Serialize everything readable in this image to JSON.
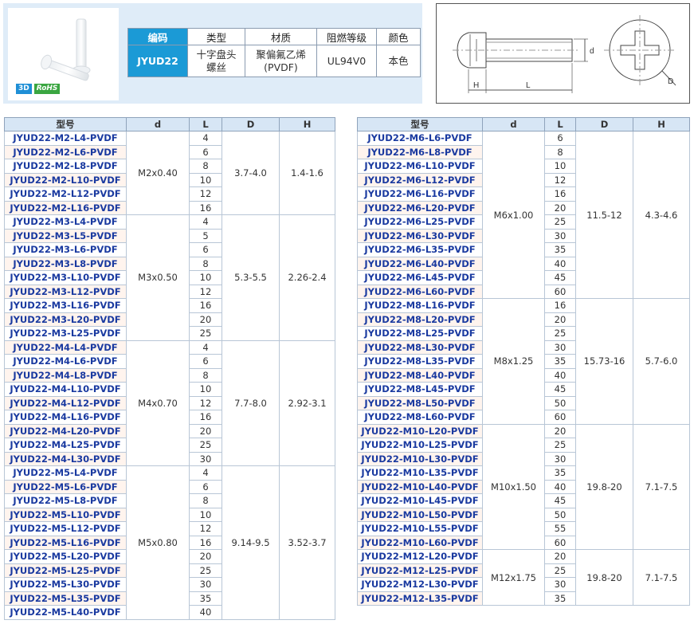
{
  "badges": {
    "threed": "3D",
    "rohs": "RoHS"
  },
  "spec": {
    "headers": [
      "编码",
      "类型",
      "材质",
      "阻燃等级",
      "颜色"
    ],
    "code": "JYUD22",
    "type_line1": "十字盘头",
    "type_line2": "螺丝",
    "material_line1": "聚偏氟乙烯",
    "material_line2": "(PVDF)",
    "flame": "UL94V0",
    "color": "本色"
  },
  "drawing": {
    "label_d": "d",
    "label_H": "H",
    "label_L": "L",
    "label_D": "D"
  },
  "table_headers": [
    "型号",
    "d",
    "L",
    "D",
    "H"
  ],
  "left_groups": [
    {
      "d": "M2x0.40",
      "D": "3.7-4.0",
      "H": "1.4-1.6",
      "rows": [
        {
          "model": "JYUD22-M2-L4-PVDF",
          "L": "4"
        },
        {
          "model": "JYUD22-M2-L6-PVDF",
          "L": "6"
        },
        {
          "model": "JYUD22-M2-L8-PVDF",
          "L": "8"
        },
        {
          "model": "JYUD22-M2-L10-PVDF",
          "L": "10"
        },
        {
          "model": "JYUD22-M2-L12-PVDF",
          "L": "12"
        },
        {
          "model": "JYUD22-M2-L16-PVDF",
          "L": "16"
        }
      ]
    },
    {
      "d": "M3x0.50",
      "D": "5.3-5.5",
      "H": "2.26-2.4",
      "rows": [
        {
          "model": "JYUD22-M3-L4-PVDF",
          "L": "4"
        },
        {
          "model": "JYUD22-M3-L5-PVDF",
          "L": "5"
        },
        {
          "model": "JYUD22-M3-L6-PVDF",
          "L": "6"
        },
        {
          "model": "JYUD22-M3-L8-PVDF",
          "L": "8"
        },
        {
          "model": "JYUD22-M3-L10-PVDF",
          "L": "10"
        },
        {
          "model": "JYUD22-M3-L12-PVDF",
          "L": "12"
        },
        {
          "model": "JYUD22-M3-L16-PVDF",
          "L": "16"
        },
        {
          "model": "JYUD22-M3-L20-PVDF",
          "L": "20"
        },
        {
          "model": "JYUD22-M3-L25-PVDF",
          "L": "25"
        }
      ]
    },
    {
      "d": "M4x0.70",
      "D": "7.7-8.0",
      "H": "2.92-3.1",
      "rows": [
        {
          "model": "JYUD22-M4-L4-PVDF",
          "L": "4"
        },
        {
          "model": "JYUD22-M4-L6-PVDF",
          "L": "6"
        },
        {
          "model": "JYUD22-M4-L8-PVDF",
          "L": "8"
        },
        {
          "model": "JYUD22-M4-L10-PVDF",
          "L": "10"
        },
        {
          "model": "JYUD22-M4-L12-PVDF",
          "L": "12"
        },
        {
          "model": "JYUD22-M4-L16-PVDF",
          "L": "16"
        },
        {
          "model": "JYUD22-M4-L20-PVDF",
          "L": "20"
        },
        {
          "model": "JYUD22-M4-L25-PVDF",
          "L": "25"
        },
        {
          "model": "JYUD22-M4-L30-PVDF",
          "L": "30"
        }
      ]
    },
    {
      "d": "M5x0.80",
      "D": "9.14-9.5",
      "H": "3.52-3.7",
      "rows": [
        {
          "model": "JYUD22-M5-L4-PVDF",
          "L": "4"
        },
        {
          "model": "JYUD22-M5-L6-PVDF",
          "L": "6"
        },
        {
          "model": "JYUD22-M5-L8-PVDF",
          "L": "8"
        },
        {
          "model": "JYUD22-M5-L10-PVDF",
          "L": "10"
        },
        {
          "model": "JYUD22-M5-L12-PVDF",
          "L": "12"
        },
        {
          "model": "JYUD22-M5-L16-PVDF",
          "L": "16"
        },
        {
          "model": "JYUD22-M5-L20-PVDF",
          "L": "20"
        },
        {
          "model": "JYUD22-M5-L25-PVDF",
          "L": "25"
        },
        {
          "model": "JYUD22-M5-L30-PVDF",
          "L": "30"
        },
        {
          "model": "JYUD22-M5-L35-PVDF",
          "L": "35"
        },
        {
          "model": "JYUD22-M5-L40-PVDF",
          "L": "40"
        }
      ]
    }
  ],
  "right_groups": [
    {
      "d": "M6x1.00",
      "D": "11.5-12",
      "H": "4.3-4.6",
      "rows": [
        {
          "model": "JYUD22-M6-L6-PVDF",
          "L": "6"
        },
        {
          "model": "JYUD22-M6-L8-PVDF",
          "L": "8"
        },
        {
          "model": "JYUD22-M6-L10-PVDF",
          "L": "10"
        },
        {
          "model": "JYUD22-M6-L12-PVDF",
          "L": "12"
        },
        {
          "model": "JYUD22-M6-L16-PVDF",
          "L": "16"
        },
        {
          "model": "JYUD22-M6-L20-PVDF",
          "L": "20"
        },
        {
          "model": "JYUD22-M6-L25-PVDF",
          "L": "25"
        },
        {
          "model": "JYUD22-M6-L30-PVDF",
          "L": "30"
        },
        {
          "model": "JYUD22-M6-L35-PVDF",
          "L": "35"
        },
        {
          "model": "JYUD22-M6-L40-PVDF",
          "L": "40"
        },
        {
          "model": "JYUD22-M6-L45-PVDF",
          "L": "45"
        },
        {
          "model": "JYUD22-M6-L60-PVDF",
          "L": "60"
        }
      ]
    },
    {
      "d": "M8x1.25",
      "D": "15.73-16",
      "H": "5.7-6.0",
      "rows": [
        {
          "model": "JYUD22-M8-L16-PVDF",
          "L": "16"
        },
        {
          "model": "JYUD22-M8-L20-PVDF",
          "L": "20"
        },
        {
          "model": "JYUD22-M8-L25-PVDF",
          "L": "25"
        },
        {
          "model": "JYUD22-M8-L30-PVDF",
          "L": "30"
        },
        {
          "model": "JYUD22-M8-L35-PVDF",
          "L": "35"
        },
        {
          "model": "JYUD22-M8-L40-PVDF",
          "L": "40"
        },
        {
          "model": "JYUD22-M8-L45-PVDF",
          "L": "45"
        },
        {
          "model": "JYUD22-M8-L50-PVDF",
          "L": "50"
        },
        {
          "model": "JYUD22-M8-L60-PVDF",
          "L": "60"
        }
      ]
    },
    {
      "d": "M10x1.50",
      "D": "19.8-20",
      "H": "7.1-7.5",
      "rows": [
        {
          "model": "JYUD22-M10-L20-PVDF",
          "L": "20"
        },
        {
          "model": "JYUD22-M10-L25-PVDF",
          "L": "25"
        },
        {
          "model": "JYUD22-M10-L30-PVDF",
          "L": "30"
        },
        {
          "model": "JYUD22-M10-L35-PVDF",
          "L": "35"
        },
        {
          "model": "JYUD22-M10-L40-PVDF",
          "L": "40"
        },
        {
          "model": "JYUD22-M10-L45-PVDF",
          "L": "45"
        },
        {
          "model": "JYUD22-M10-L50-PVDF",
          "L": "50"
        },
        {
          "model": "JYUD22-M10-L55-PVDF",
          "L": "55"
        },
        {
          "model": "JYUD22-M10-L60-PVDF",
          "L": "60"
        }
      ]
    },
    {
      "d": "M12x1.75",
      "D": "19.8-20",
      "H": "7.1-7.5",
      "rows": [
        {
          "model": "JYUD22-M12-L20-PVDF",
          "L": "20"
        },
        {
          "model": "JYUD22-M12-L25-PVDF",
          "L": "25"
        },
        {
          "model": "JYUD22-M12-L30-PVDF",
          "L": "30"
        },
        {
          "model": "JYUD22-M12-L35-PVDF",
          "L": "35"
        }
      ]
    }
  ],
  "colors": {
    "accent": "#1b9ad6",
    "panel": "#dfecf8",
    "model_text": "#1a3aa0",
    "header_bg": "#d7e6f5"
  },
  "icons": {
    "product": "screw-photo-icon",
    "drawing": "screw-technical-drawing-icon"
  }
}
